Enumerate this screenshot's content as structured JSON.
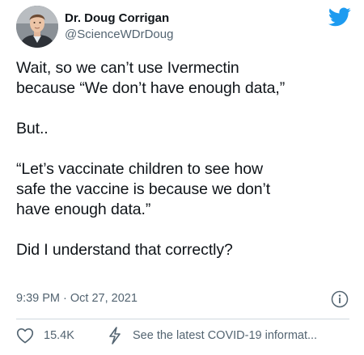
{
  "author": {
    "display_name": "Dr. Doug Corrigan",
    "handle": "@ScienceWDrDoug"
  },
  "tweet": {
    "text": "Wait, so we can’t use Ivermectin\nbecause “We don’t have enough data,”\n\nBut..\n\n“Let’s vaccinate children to see how\nsafe the vaccine is because we don’t\nhave enough data.”\n\nDid I understand that correctly?",
    "timestamp": "9:39 PM · Oct 27, 2021"
  },
  "actions": {
    "likes": "15.4K",
    "covid_link": "See the latest COVID-19 informat..."
  },
  "icons": {
    "brand": "twitter-bird-icon",
    "info": "info-icon",
    "like": "heart-icon",
    "covid": "lightning-icon"
  },
  "colors": {
    "twitter_blue": "#1d9bf0",
    "text_primary": "#0f1419",
    "text_secondary": "#536471",
    "divider": "#cfd9de"
  }
}
